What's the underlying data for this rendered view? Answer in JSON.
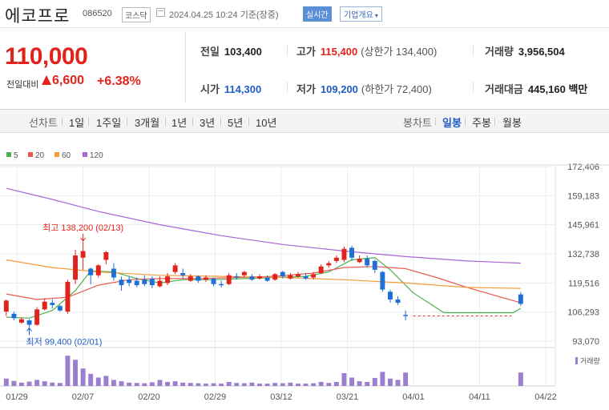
{
  "header": {
    "name": "에코프로",
    "code": "086520",
    "market": "코스닥",
    "datetime": "2024.04.25 10:24  기준(장중)",
    "realtime": "실시간",
    "company_info": "기업개요"
  },
  "quote": {
    "price": "110,000",
    "change_label": "전일대비",
    "change": "6,600",
    "change_pct": "+6.38%",
    "prev_label": "전일",
    "prev": "103,400",
    "high_label": "고가",
    "high": "115,400",
    "upper_limit": "(상한가 134,400)",
    "volume_label": "거래량",
    "volume": "3,956,504",
    "open_label": "시가",
    "open": "114,300",
    "low_label": "저가",
    "low": "109,200",
    "lower_limit": "(하한가 72,400)",
    "amount_label": "거래대금",
    "amount": "445,160 백만"
  },
  "controls": {
    "line_label": "선차트",
    "periods": [
      "1일",
      "1주일",
      "3개월",
      "1년",
      "3년",
      "5년",
      "10년"
    ],
    "candle_label": "봉차트",
    "candles": [
      "일봉",
      "주봉",
      "월봉"
    ],
    "active_candle": "일봉"
  },
  "chart_data": {
    "type": "candlestick",
    "legend": [
      {
        "name": "5",
        "color": "#4caf50"
      },
      {
        "name": "20",
        "color": "#e85a4f"
      },
      {
        "name": "60",
        "color": "#f59a3a"
      },
      {
        "name": "120",
        "color": "#a865d6"
      }
    ],
    "colors": {
      "up": "#e0231c",
      "down": "#1f6fd6",
      "volume": "#9c7ed1"
    },
    "yticks": [
      "172,406",
      "159,183",
      "145,961",
      "132,738",
      "119,516",
      "106,293",
      "93,070"
    ],
    "ylim": [
      93070,
      172406
    ],
    "xticks": [
      "01/29",
      "02/07",
      "02/20",
      "02/29",
      "03/12",
      "03/21",
      "04/01",
      "04/11",
      "04/22"
    ],
    "volume_label": "거래량",
    "annotations": {
      "high": "최고 138,200 (02/13)",
      "low": "최저 99,400 (02/01)"
    },
    "candles": [
      {
        "x": 0,
        "o": 106500,
        "c": 111500,
        "h": 112000,
        "l": 104500,
        "v": 0.22
      },
      {
        "x": 1,
        "o": 105500,
        "c": 103500,
        "h": 106500,
        "l": 102500,
        "v": 0.15
      },
      {
        "x": 2,
        "o": 101500,
        "c": 103000,
        "h": 104000,
        "l": 101000,
        "v": 0.1
      },
      {
        "x": 3,
        "o": 102500,
        "c": 100500,
        "h": 103000,
        "l": 99400,
        "v": 0.13
      },
      {
        "x": 4,
        "o": 100500,
        "c": 107500,
        "h": 108500,
        "l": 100000,
        "v": 0.18
      },
      {
        "x": 5,
        "o": 107500,
        "c": 111000,
        "h": 112500,
        "l": 107000,
        "v": 0.14
      },
      {
        "x": 6,
        "o": 110500,
        "c": 109500,
        "h": 112000,
        "l": 108000,
        "v": 0.1
      },
      {
        "x": 7,
        "o": 109000,
        "c": 107000,
        "h": 109500,
        "l": 106500,
        "v": 0.09
      },
      {
        "x": 8,
        "o": 106500,
        "c": 120000,
        "h": 121000,
        "l": 105500,
        "v": 0.9
      },
      {
        "x": 9,
        "o": 121000,
        "c": 132000,
        "h": 134500,
        "l": 119000,
        "v": 0.78
      },
      {
        "x": 10,
        "o": 131000,
        "c": 134000,
        "h": 138200,
        "l": 125500,
        "v": 0.52
      },
      {
        "x": 11,
        "o": 126000,
        "c": 123000,
        "h": 126500,
        "l": 119000,
        "v": 0.36
      },
      {
        "x": 12,
        "o": 123000,
        "c": 127500,
        "h": 128000,
        "l": 122000,
        "v": 0.25
      },
      {
        "x": 13,
        "o": 130000,
        "c": 133500,
        "h": 134000,
        "l": 128000,
        "v": 0.3
      },
      {
        "x": 14,
        "o": 126000,
        "c": 122000,
        "h": 128500,
        "l": 120500,
        "v": 0.18
      },
      {
        "x": 15,
        "o": 121000,
        "c": 118500,
        "h": 122500,
        "l": 116000,
        "v": 0.14
      },
      {
        "x": 16,
        "o": 121000,
        "c": 119500,
        "h": 122500,
        "l": 118000,
        "v": 0.1
      },
      {
        "x": 17,
        "o": 120500,
        "c": 118500,
        "h": 122000,
        "l": 117500,
        "v": 0.09
      },
      {
        "x": 18,
        "o": 121000,
        "c": 119000,
        "h": 123000,
        "l": 118000,
        "v": 0.08
      },
      {
        "x": 19,
        "o": 121500,
        "c": 118500,
        "h": 122500,
        "l": 117000,
        "v": 0.11
      },
      {
        "x": 20,
        "o": 118000,
        "c": 120500,
        "h": 122500,
        "l": 117500,
        "v": 0.18
      },
      {
        "x": 21,
        "o": 119500,
        "c": 122500,
        "h": 124000,
        "l": 118500,
        "v": 0.12
      },
      {
        "x": 22,
        "o": 124500,
        "c": 127500,
        "h": 128500,
        "l": 123500,
        "v": 0.14
      },
      {
        "x": 23,
        "o": 124000,
        "c": 123000,
        "h": 126000,
        "l": 121500,
        "v": 0.1
      },
      {
        "x": 24,
        "o": 120500,
        "c": 122500,
        "h": 123500,
        "l": 120000,
        "v": 0.09
      },
      {
        "x": 25,
        "o": 122500,
        "c": 120500,
        "h": 123000,
        "l": 119500,
        "v": 0.08
      },
      {
        "x": 26,
        "o": 121000,
        "c": 122000,
        "h": 123000,
        "l": 120000,
        "v": 0.07
      },
      {
        "x": 27,
        "o": 121500,
        "c": 119000,
        "h": 122000,
        "l": 118000,
        "v": 0.08
      },
      {
        "x": 28,
        "o": 119000,
        "c": 118500,
        "h": 120500,
        "l": 117500,
        "v": 0.07
      },
      {
        "x": 29,
        "o": 119000,
        "c": 123000,
        "h": 124000,
        "l": 118500,
        "v": 0.12
      },
      {
        "x": 30,
        "o": 122500,
        "c": 122000,
        "h": 124000,
        "l": 121000,
        "v": 0.09
      },
      {
        "x": 31,
        "o": 123000,
        "c": 124500,
        "h": 125000,
        "l": 122000,
        "v": 0.08
      },
      {
        "x": 32,
        "o": 122500,
        "c": 121000,
        "h": 123500,
        "l": 120500,
        "v": 0.1
      },
      {
        "x": 33,
        "o": 121500,
        "c": 122500,
        "h": 123500,
        "l": 121000,
        "v": 0.07
      },
      {
        "x": 34,
        "o": 122000,
        "c": 120500,
        "h": 123000,
        "l": 120000,
        "v": 0.07
      },
      {
        "x": 35,
        "o": 121000,
        "c": 123500,
        "h": 124000,
        "l": 120500,
        "v": 0.09
      },
      {
        "x": 36,
        "o": 124500,
        "c": 122500,
        "h": 125000,
        "l": 121500,
        "v": 0.08
      },
      {
        "x": 37,
        "o": 121500,
        "c": 123000,
        "h": 124000,
        "l": 121000,
        "v": 0.1
      },
      {
        "x": 38,
        "o": 122500,
        "c": 123500,
        "h": 124500,
        "l": 122000,
        "v": 0.07
      },
      {
        "x": 39,
        "o": 122500,
        "c": 121500,
        "h": 124000,
        "l": 121000,
        "v": 0.07
      },
      {
        "x": 40,
        "o": 122000,
        "c": 123500,
        "h": 124500,
        "l": 121000,
        "v": 0.08
      },
      {
        "x": 41,
        "o": 124000,
        "c": 127000,
        "h": 128000,
        "l": 123500,
        "v": 0.12
      },
      {
        "x": 42,
        "o": 127500,
        "c": 128500,
        "h": 129500,
        "l": 126500,
        "v": 0.09
      },
      {
        "x": 43,
        "o": 129500,
        "c": 131000,
        "h": 132000,
        "l": 128500,
        "v": 0.12
      },
      {
        "x": 44,
        "o": 130000,
        "c": 135000,
        "h": 136000,
        "l": 129000,
        "v": 0.38
      },
      {
        "x": 45,
        "o": 135500,
        "c": 131000,
        "h": 136500,
        "l": 129500,
        "v": 0.25
      },
      {
        "x": 46,
        "o": 129000,
        "c": 130500,
        "h": 132000,
        "l": 128500,
        "v": 0.14
      },
      {
        "x": 47,
        "o": 130500,
        "c": 127500,
        "h": 132000,
        "l": 126500,
        "v": 0.12
      },
      {
        "x": 48,
        "o": 129500,
        "c": 125500,
        "h": 130000,
        "l": 124000,
        "v": 0.24
      },
      {
        "x": 49,
        "o": 124500,
        "c": 116500,
        "h": 125000,
        "l": 115500,
        "v": 0.42
      },
      {
        "x": 50,
        "o": 115500,
        "c": 112000,
        "h": 116500,
        "l": 110500,
        "v": 0.22
      },
      {
        "x": 51,
        "o": 112000,
        "c": 110500,
        "h": 113500,
        "l": 109500,
        "v": 0.18
      },
      {
        "x": 52,
        "o": 105000,
        "c": 104500,
        "h": 107000,
        "l": 102500,
        "v": 0.4
      },
      {
        "x": 67,
        "o": 114300,
        "c": 110000,
        "h": 115400,
        "l": 109200,
        "v": 0.4
      }
    ],
    "ma": {
      "ma5": [
        [
          0,
          104000
        ],
        [
          3,
          103500
        ],
        [
          6,
          107000
        ],
        [
          9,
          116000
        ],
        [
          11,
          125000
        ],
        [
          14,
          124500
        ],
        [
          17,
          121500
        ],
        [
          20,
          119500
        ],
        [
          23,
          121000
        ],
        [
          27,
          121000
        ],
        [
          31,
          121500
        ],
        [
          35,
          122000
        ],
        [
          39,
          122500
        ],
        [
          42,
          124500
        ],
        [
          45,
          130000
        ],
        [
          48,
          131000
        ],
        [
          50,
          125500
        ],
        [
          53,
          115000
        ],
        [
          57,
          106000
        ],
        [
          66,
          106000
        ],
        [
          67,
          108000
        ]
      ],
      "ma20": [
        [
          0,
          114500
        ],
        [
          4,
          112000
        ],
        [
          8,
          113000
        ],
        [
          12,
          118500
        ],
        [
          16,
          121000
        ],
        [
          20,
          121500
        ],
        [
          25,
          121500
        ],
        [
          30,
          122000
        ],
        [
          35,
          122500
        ],
        [
          40,
          124000
        ],
        [
          44,
          126500
        ],
        [
          48,
          127000
        ],
        [
          52,
          126000
        ],
        [
          56,
          122000
        ],
        [
          60,
          117500
        ],
        [
          64,
          113500
        ],
        [
          67,
          110500
        ]
      ],
      "ma60": [
        [
          0,
          130000
        ],
        [
          6,
          126500
        ],
        [
          12,
          124500
        ],
        [
          20,
          123000
        ],
        [
          28,
          122500
        ],
        [
          36,
          122000
        ],
        [
          44,
          121000
        ],
        [
          52,
          119500
        ],
        [
          60,
          117500
        ],
        [
          67,
          117000
        ]
      ],
      "ma120": [
        [
          0,
          162500
        ],
        [
          6,
          157500
        ],
        [
          12,
          152000
        ],
        [
          20,
          146000
        ],
        [
          28,
          141000
        ],
        [
          36,
          137000
        ],
        [
          44,
          134000
        ],
        [
          52,
          131500
        ],
        [
          60,
          129500
        ],
        [
          67,
          128500
        ]
      ]
    },
    "dashed_level": 104500
  }
}
